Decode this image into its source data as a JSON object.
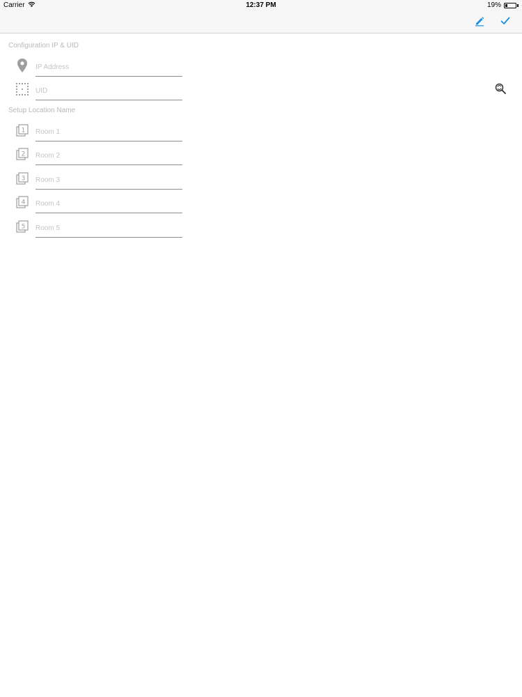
{
  "status_bar": {
    "carrier": "Carrier",
    "time": "12:37 PM",
    "battery": "19%",
    "battery_level": 0.19
  },
  "nav": {
    "edit_icon": "pencil-icon",
    "done_icon": "checkmark-icon",
    "accent_color": "#1a8fe0"
  },
  "config_section": {
    "title": "Configuration IP & UID",
    "ip_field": {
      "placeholder": "IP Address",
      "value": "",
      "icon": "location-pin-icon"
    },
    "uid_field": {
      "placeholder": "UID",
      "value": "",
      "icon": "dotted-grid-icon"
    },
    "search_icon": "search-refresh-icon"
  },
  "location_section": {
    "title": "Setup Location Name",
    "rooms": [
      {
        "placeholder": "Room 1",
        "value": "",
        "badge": "1"
      },
      {
        "placeholder": "Room 2",
        "value": "",
        "badge": "2"
      },
      {
        "placeholder": "Room 3",
        "value": "",
        "badge": "3"
      },
      {
        "placeholder": "Room 4",
        "value": "",
        "badge": "4"
      },
      {
        "placeholder": "Room 5",
        "value": "",
        "badge": "5"
      }
    ]
  }
}
